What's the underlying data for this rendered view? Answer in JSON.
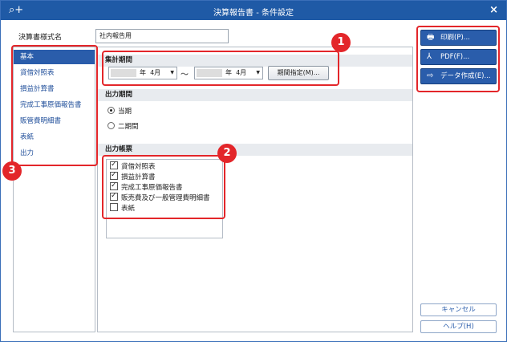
{
  "window": {
    "title": "決算報告書 - 条件設定",
    "close_label": "×"
  },
  "form_style": {
    "label": "決算書様式名",
    "value": "社内報告用"
  },
  "sidebar": {
    "items": [
      {
        "label": "基本",
        "active": true
      },
      {
        "label": "貸借対照表"
      },
      {
        "label": "損益計算書"
      },
      {
        "label": "完成工事原価報告書"
      },
      {
        "label": "販管費明細書"
      },
      {
        "label": "表紙"
      },
      {
        "label": "出力"
      }
    ]
  },
  "period": {
    "heading": "集計期間",
    "from_year": "年",
    "from_month": "4月",
    "tilde": "～",
    "to_year": "年",
    "to_month": "4月",
    "specify_button": "期間指定(M)..."
  },
  "output_period": {
    "heading": "出力期間",
    "options": [
      {
        "label": "当期",
        "selected": true
      },
      {
        "label": "二期間",
        "selected": false
      }
    ]
  },
  "output_forms": {
    "heading": "出力帳票",
    "items": [
      {
        "label": "貸借対照表",
        "checked": true
      },
      {
        "label": "損益計算書",
        "checked": true
      },
      {
        "label": "完成工事原価報告書",
        "checked": true
      },
      {
        "label": "販売費及び一般管理費明細書",
        "checked": true
      },
      {
        "label": "表紙",
        "checked": false
      }
    ]
  },
  "actions": {
    "print": "印刷(P)...",
    "pdf": "PDF(F)...",
    "data": "データ作成(E)...",
    "cancel": "キャンセル",
    "help": "ヘルプ(H)"
  },
  "badges": [
    "1",
    "2",
    "3"
  ],
  "colors": {
    "titlebar": "#1f5aa6",
    "accent": "#2a5dab",
    "highlight": "#e3262a"
  }
}
